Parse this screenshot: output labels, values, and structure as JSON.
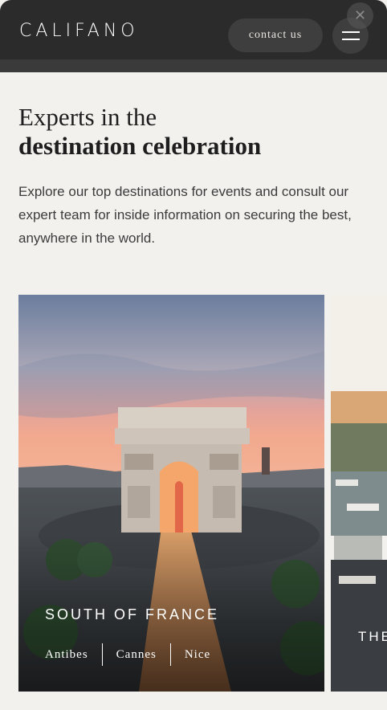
{
  "header": {
    "logo": "CALIFANO",
    "contact_label": "contact us",
    "close_icon": "close-icon",
    "menu_icon": "hamburger-menu-icon"
  },
  "hero": {
    "title_line1": "Experts in the",
    "title_line2": "destination celebration",
    "intro": "Explore our top destinations for events and consult our expert team for inside information on securing the best, anywhere in the world."
  },
  "destinations": [
    {
      "title": "SOUTH OF FRANCE",
      "links": [
        "Antibes",
        "Cannes",
        "Nice"
      ]
    },
    {
      "title": "THE"
    }
  ],
  "colors": {
    "header_bg": "#2b2b2b",
    "page_bg": "#f2f1ee",
    "text_dark": "#1e1e1e"
  }
}
